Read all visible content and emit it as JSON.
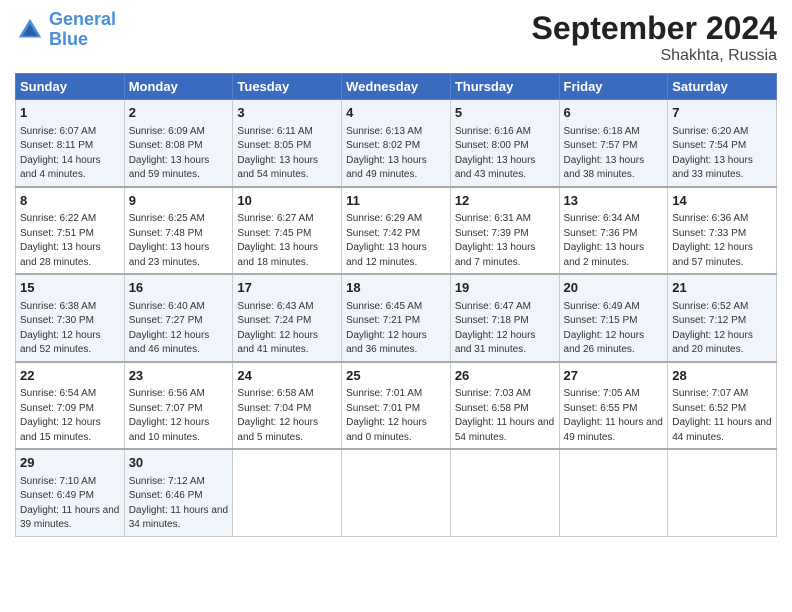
{
  "header": {
    "logo_line1": "General",
    "logo_line2": "Blue",
    "month": "September 2024",
    "location": "Shakhta, Russia"
  },
  "days_of_week": [
    "Sunday",
    "Monday",
    "Tuesday",
    "Wednesday",
    "Thursday",
    "Friday",
    "Saturday"
  ],
  "weeks": [
    [
      {
        "day": "1",
        "sunrise": "Sunrise: 6:07 AM",
        "sunset": "Sunset: 8:11 PM",
        "daylight": "Daylight: 14 hours and 4 minutes."
      },
      {
        "day": "2",
        "sunrise": "Sunrise: 6:09 AM",
        "sunset": "Sunset: 8:08 PM",
        "daylight": "Daylight: 13 hours and 59 minutes."
      },
      {
        "day": "3",
        "sunrise": "Sunrise: 6:11 AM",
        "sunset": "Sunset: 8:05 PM",
        "daylight": "Daylight: 13 hours and 54 minutes."
      },
      {
        "day": "4",
        "sunrise": "Sunrise: 6:13 AM",
        "sunset": "Sunset: 8:02 PM",
        "daylight": "Daylight: 13 hours and 49 minutes."
      },
      {
        "day": "5",
        "sunrise": "Sunrise: 6:16 AM",
        "sunset": "Sunset: 8:00 PM",
        "daylight": "Daylight: 13 hours and 43 minutes."
      },
      {
        "day": "6",
        "sunrise": "Sunrise: 6:18 AM",
        "sunset": "Sunset: 7:57 PM",
        "daylight": "Daylight: 13 hours and 38 minutes."
      },
      {
        "day": "7",
        "sunrise": "Sunrise: 6:20 AM",
        "sunset": "Sunset: 7:54 PM",
        "daylight": "Daylight: 13 hours and 33 minutes."
      }
    ],
    [
      {
        "day": "8",
        "sunrise": "Sunrise: 6:22 AM",
        "sunset": "Sunset: 7:51 PM",
        "daylight": "Daylight: 13 hours and 28 minutes."
      },
      {
        "day": "9",
        "sunrise": "Sunrise: 6:25 AM",
        "sunset": "Sunset: 7:48 PM",
        "daylight": "Daylight: 13 hours and 23 minutes."
      },
      {
        "day": "10",
        "sunrise": "Sunrise: 6:27 AM",
        "sunset": "Sunset: 7:45 PM",
        "daylight": "Daylight: 13 hours and 18 minutes."
      },
      {
        "day": "11",
        "sunrise": "Sunrise: 6:29 AM",
        "sunset": "Sunset: 7:42 PM",
        "daylight": "Daylight: 13 hours and 12 minutes."
      },
      {
        "day": "12",
        "sunrise": "Sunrise: 6:31 AM",
        "sunset": "Sunset: 7:39 PM",
        "daylight": "Daylight: 13 hours and 7 minutes."
      },
      {
        "day": "13",
        "sunrise": "Sunrise: 6:34 AM",
        "sunset": "Sunset: 7:36 PM",
        "daylight": "Daylight: 13 hours and 2 minutes."
      },
      {
        "day": "14",
        "sunrise": "Sunrise: 6:36 AM",
        "sunset": "Sunset: 7:33 PM",
        "daylight": "Daylight: 12 hours and 57 minutes."
      }
    ],
    [
      {
        "day": "15",
        "sunrise": "Sunrise: 6:38 AM",
        "sunset": "Sunset: 7:30 PM",
        "daylight": "Daylight: 12 hours and 52 minutes."
      },
      {
        "day": "16",
        "sunrise": "Sunrise: 6:40 AM",
        "sunset": "Sunset: 7:27 PM",
        "daylight": "Daylight: 12 hours and 46 minutes."
      },
      {
        "day": "17",
        "sunrise": "Sunrise: 6:43 AM",
        "sunset": "Sunset: 7:24 PM",
        "daylight": "Daylight: 12 hours and 41 minutes."
      },
      {
        "day": "18",
        "sunrise": "Sunrise: 6:45 AM",
        "sunset": "Sunset: 7:21 PM",
        "daylight": "Daylight: 12 hours and 36 minutes."
      },
      {
        "day": "19",
        "sunrise": "Sunrise: 6:47 AM",
        "sunset": "Sunset: 7:18 PM",
        "daylight": "Daylight: 12 hours and 31 minutes."
      },
      {
        "day": "20",
        "sunrise": "Sunrise: 6:49 AM",
        "sunset": "Sunset: 7:15 PM",
        "daylight": "Daylight: 12 hours and 26 minutes."
      },
      {
        "day": "21",
        "sunrise": "Sunrise: 6:52 AM",
        "sunset": "Sunset: 7:12 PM",
        "daylight": "Daylight: 12 hours and 20 minutes."
      }
    ],
    [
      {
        "day": "22",
        "sunrise": "Sunrise: 6:54 AM",
        "sunset": "Sunset: 7:09 PM",
        "daylight": "Daylight: 12 hours and 15 minutes."
      },
      {
        "day": "23",
        "sunrise": "Sunrise: 6:56 AM",
        "sunset": "Sunset: 7:07 PM",
        "daylight": "Daylight: 12 hours and 10 minutes."
      },
      {
        "day": "24",
        "sunrise": "Sunrise: 6:58 AM",
        "sunset": "Sunset: 7:04 PM",
        "daylight": "Daylight: 12 hours and 5 minutes."
      },
      {
        "day": "25",
        "sunrise": "Sunrise: 7:01 AM",
        "sunset": "Sunset: 7:01 PM",
        "daylight": "Daylight: 12 hours and 0 minutes."
      },
      {
        "day": "26",
        "sunrise": "Sunrise: 7:03 AM",
        "sunset": "Sunset: 6:58 PM",
        "daylight": "Daylight: 11 hours and 54 minutes."
      },
      {
        "day": "27",
        "sunrise": "Sunrise: 7:05 AM",
        "sunset": "Sunset: 6:55 PM",
        "daylight": "Daylight: 11 hours and 49 minutes."
      },
      {
        "day": "28",
        "sunrise": "Sunrise: 7:07 AM",
        "sunset": "Sunset: 6:52 PM",
        "daylight": "Daylight: 11 hours and 44 minutes."
      }
    ],
    [
      {
        "day": "29",
        "sunrise": "Sunrise: 7:10 AM",
        "sunset": "Sunset: 6:49 PM",
        "daylight": "Daylight: 11 hours and 39 minutes."
      },
      {
        "day": "30",
        "sunrise": "Sunrise: 7:12 AM",
        "sunset": "Sunset: 6:46 PM",
        "daylight": "Daylight: 11 hours and 34 minutes."
      },
      null,
      null,
      null,
      null,
      null
    ]
  ]
}
